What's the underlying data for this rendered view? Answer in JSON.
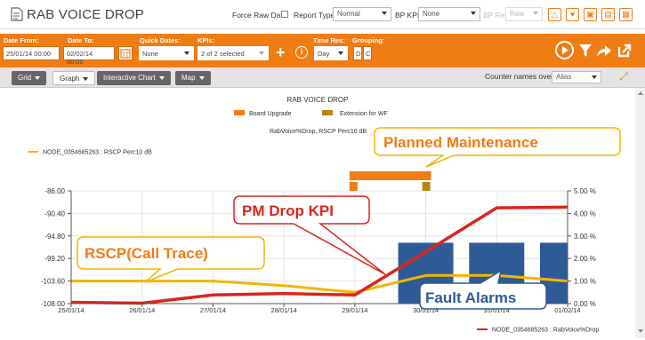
{
  "header": {
    "title": "RAB VOICE DROP",
    "force_raw_label": "Force Raw Data",
    "report_type_label": "Report Type:",
    "report_type_value": "Normal",
    "bp_kpi_label": "BP KPI:",
    "bp_kpi_value": "None",
    "bp_res_label": "BP Res",
    "bp_res_value": "Raw"
  },
  "filters": {
    "date_from_label": "Date From:",
    "date_from_value": "25/01/14 00:00",
    "date_to_label": "Date To:",
    "date_to_value": "02/02/14 00:00",
    "quick_dates_label": "Quick Dates:",
    "quick_dates_value": "None",
    "kpis_label": "KPIs:",
    "kpis_value": "2 of 2 selected",
    "time_res_label": "Time Res:",
    "time_res_value": "Day",
    "grouping_label": "Grouping:",
    "grouping_d": "D",
    "grouping_c": "C"
  },
  "tabs": {
    "grid": "Grid",
    "graph": "Graph",
    "interactive_chart": "Interactive Chart",
    "map": "Map",
    "counter_names_label": "Counter names over:",
    "counter_names_value": "Alias"
  },
  "chart_data": {
    "type": "line",
    "title": "RAB VOICE DROP",
    "subtitle": "RabVoice%Drop, RSCP Perc10 dB",
    "x": [
      "25/01/14",
      "26/01/14",
      "27/01/14",
      "28/01/14",
      "29/01/14",
      "30/01/14",
      "31/01/14",
      "01/02/14"
    ],
    "series": [
      {
        "name": "NODE_0354685263 : RSCP Perc10 dB",
        "axis": "left",
        "color": "#f5b400",
        "values": [
          -103.6,
          -103.6,
          -103.6,
          -104.5,
          -105.8,
          -102.5,
          -102.5,
          -103.6
        ]
      },
      {
        "name": "NODE_0354685263 : RabVoice%Drop",
        "axis": "right",
        "color": "#d9261c",
        "values": [
          0.06,
          0.02,
          0.38,
          0.45,
          0.38,
          2.3,
          4.25,
          4.28
        ]
      }
    ],
    "event_legend": [
      {
        "name": "Board Upgrade",
        "color": "#f07c14"
      },
      {
        "name": "Extension for WF",
        "color": "#b8860b"
      }
    ],
    "left_axis": {
      "ticks": [
        "-86.00",
        "-90.40",
        "-94.80",
        "-99.20",
        "-103.60",
        "-108.00"
      ],
      "range": [
        -108.0,
        -86.0
      ]
    },
    "right_axis": {
      "ticks": [
        "5.00 %",
        "4.00 %",
        "3.00 %",
        "2.00 %",
        "1.00 %",
        "0.00 %"
      ],
      "range": [
        0,
        5
      ]
    },
    "fault_alarm_days": [
      "30/01/14",
      "31/01/14",
      "01/02/14"
    ],
    "fault_alarm_height_pct": 2.7,
    "event_bar_span": [
      "29/01/14",
      "30/01/14"
    ],
    "grid": true,
    "legend_position": "top-left / bottom-right"
  },
  "annotations": {
    "planned_maintenance": "Planned Maintenance",
    "pm_drop_kpi": "PM Drop KPI",
    "rscp_call_trace": "RSCP(Call Trace)",
    "fault_alarms": "Fault Alarms"
  },
  "colors": {
    "accent": "#f07c14",
    "alarm_bar": "#2e5b95",
    "rscp_line": "#f5b400",
    "drop_line": "#d9261c"
  }
}
